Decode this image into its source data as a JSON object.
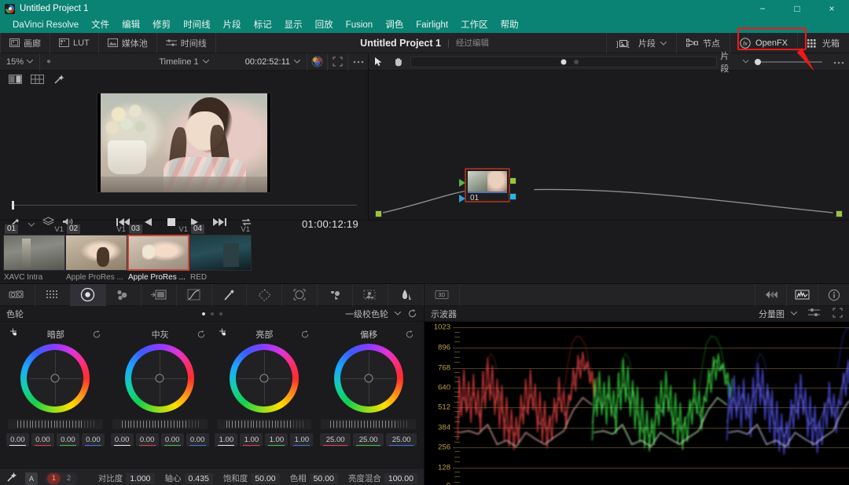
{
  "window": {
    "title": "Untitled Project 1",
    "minimize": "−",
    "maximize": "□",
    "close": "×"
  },
  "menu": {
    "items": [
      "DaVinci Resolve",
      "文件",
      "编辑",
      "修剪",
      "时间线",
      "片段",
      "标记",
      "显示",
      "回放",
      "Fusion",
      "调色",
      "Fairlight",
      "工作区",
      "帮助"
    ]
  },
  "topbar": {
    "left_items": [
      {
        "label": "画廊",
        "icon": "gallery-icon"
      },
      {
        "label": "LUT",
        "icon": "lut-icon"
      },
      {
        "label": "媒体池",
        "icon": "media-pool-icon"
      },
      {
        "label": "时间线",
        "icon": "timeline-icon"
      }
    ],
    "project_name": "Untitled Project 1",
    "project_state": "经过编辑",
    "right_items": [
      {
        "label": "片段",
        "icon": "clips-icon"
      },
      {
        "label": "节点",
        "icon": "nodes-icon"
      },
      {
        "label": "OpenFX",
        "icon": "fx-icon"
      },
      {
        "label": "光箱",
        "icon": "lightbox-icon"
      }
    ],
    "highlight_color": "#f01818"
  },
  "viewer": {
    "zoom": "15%",
    "timeline_name": "Timeline 1",
    "duration": "00:02:52:11",
    "current_timecode": "01:00:12:19",
    "transport": [
      "first-frame",
      "reverse-play",
      "stop",
      "play",
      "last-frame",
      "loop"
    ],
    "tools": [
      "color-picker",
      "layers",
      "audio"
    ]
  },
  "nodes": {
    "tools": [
      "arrow-select-icon",
      "hand-pan-icon"
    ],
    "mode_label": "片段",
    "node": {
      "number": "01"
    }
  },
  "clips": [
    {
      "number": "01",
      "track": "V1",
      "name": "XAVC Intra",
      "selected": false
    },
    {
      "number": "02",
      "track": "V1",
      "name": "Apple ProRes ...",
      "selected": false
    },
    {
      "number": "03",
      "track": "V1",
      "name": "Apple ProRes ...",
      "selected": true
    },
    {
      "number": "04",
      "track": "V1",
      "name": "RED",
      "selected": false
    }
  ],
  "palette": {
    "icons": [
      "camera-raw-icon",
      "color-match-icon",
      "color-wheels-icon",
      "primaries-bars-icon",
      "log-wheels-icon",
      "curves-icon",
      "color-warper-icon",
      "qualifier-icon",
      "power-window-icon",
      "tracker-icon",
      "magic-mask-icon",
      "blur-icon",
      "key-icon",
      "sizing-icon",
      "3d-icon",
      "stereo-icon",
      "scopes-icon",
      "info-icon"
    ],
    "panel_title": "色轮",
    "mode": "一级校色轮",
    "reset_icon": "reset-icon",
    "page_dots": 3,
    "active_dot": 0
  },
  "wheels": [
    {
      "label": "暗部",
      "values": [
        "0.00",
        "0.00",
        "0.00",
        "0.00"
      ],
      "reset": "reset-icon"
    },
    {
      "label": "中灰",
      "values": [
        "0.00",
        "0.00",
        "0.00",
        "0.00"
      ],
      "reset": "reset-icon"
    },
    {
      "label": "亮部",
      "values": [
        "1.00",
        "1.00",
        "1.00",
        "1.00"
      ],
      "reset": "reset-icon"
    },
    {
      "label": "偏移",
      "values": [
        "25.00",
        "25.00",
        "25.00"
      ],
      "reset": "reset-icon"
    }
  ],
  "statusbar": {
    "node_icon": "wand-icon",
    "letter_badge": "A",
    "pages": [
      "1",
      "2"
    ],
    "active_page": "1",
    "fields": [
      {
        "label": "对比度",
        "value": "1.000"
      },
      {
        "label": "轴心",
        "value": "0.435"
      },
      {
        "label": "饱和度",
        "value": "50.00"
      },
      {
        "label": "色相",
        "value": "50.00"
      },
      {
        "label": "亮度混合",
        "value": "100.00"
      }
    ]
  },
  "scope": {
    "title": "示波器",
    "mode": "分量图",
    "settings_icon": "sliders-icon",
    "expand_icon": "expand-icon"
  },
  "chart_data": {
    "type": "line",
    "title": "分量图",
    "ylabel": "",
    "xlabel": "",
    "ylim": [
      0,
      1023
    ],
    "yticks": [
      0,
      128,
      256,
      384,
      512,
      640,
      768,
      896,
      1023
    ],
    "grid": true,
    "legend": "none",
    "series": [
      {
        "name": "Red",
        "color": "#e04a4a",
        "x_range": [
          0.01,
          0.33
        ]
      },
      {
        "name": "Green",
        "color": "#2ee03c",
        "x_range": [
          0.35,
          0.67
        ]
      },
      {
        "name": "Blue",
        "color": "#5050f0",
        "x_range": [
          0.69,
          1.0
        ]
      }
    ]
  }
}
